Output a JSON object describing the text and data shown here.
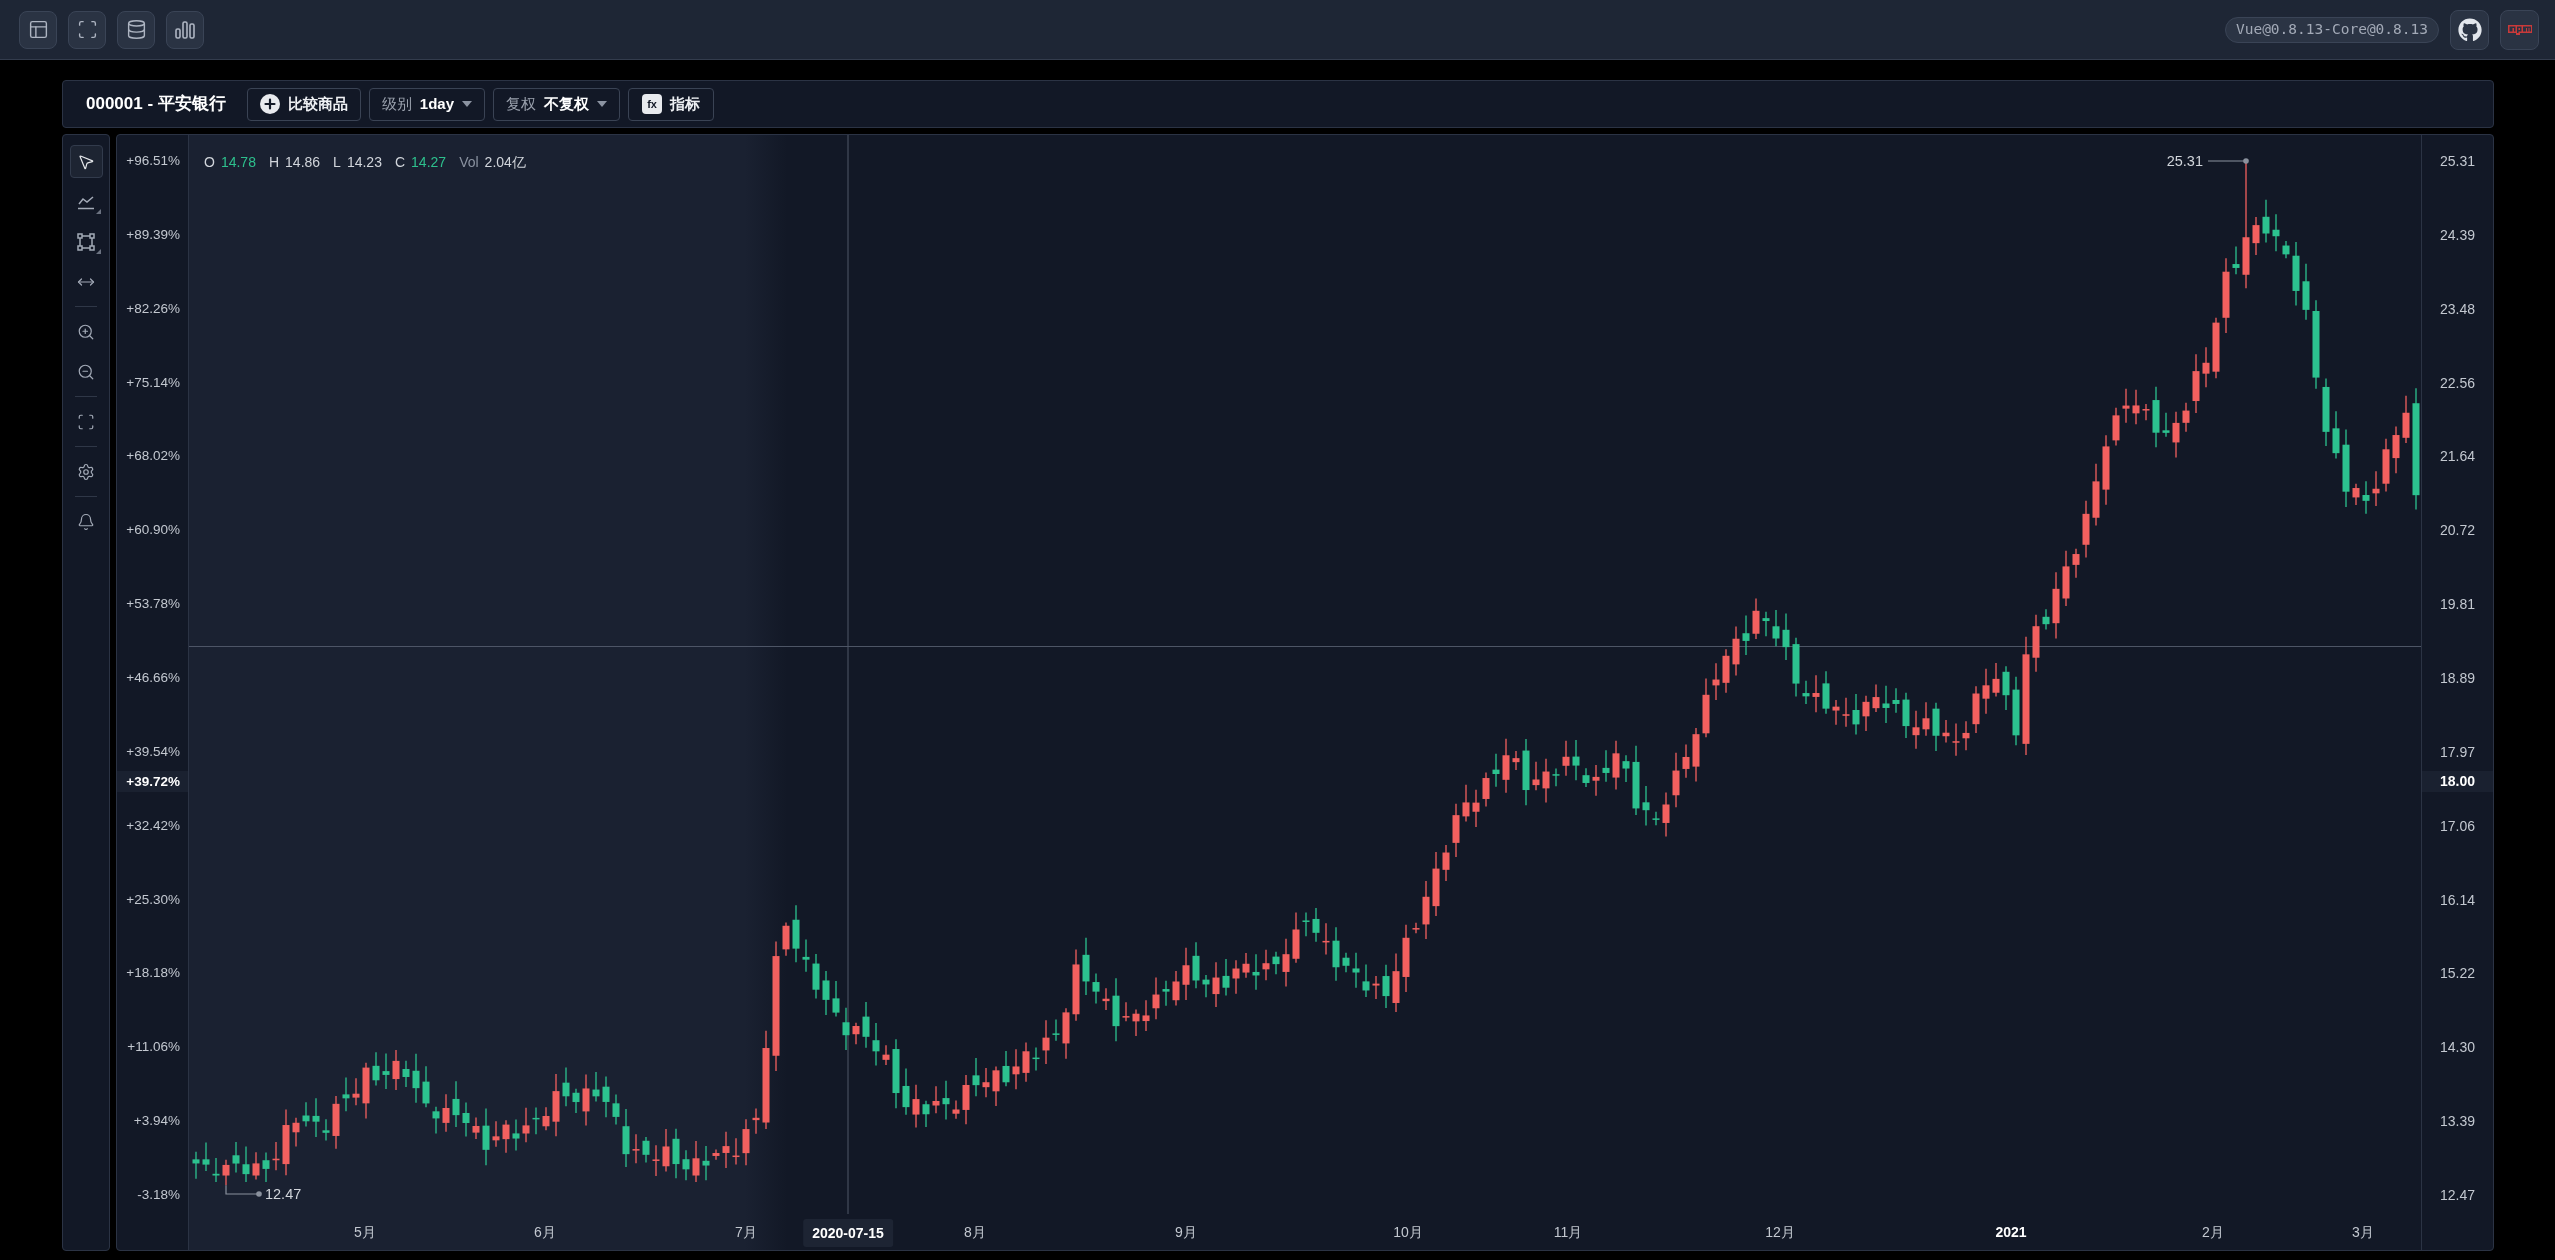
{
  "top_bar": {
    "tools": [
      {
        "kind": "layout"
      },
      {
        "kind": "fullscreen"
      },
      {
        "kind": "database"
      },
      {
        "kind": "bar-chart"
      }
    ],
    "version_badge": "Vue@0.8.13-Core@0.8.13",
    "links": [
      {
        "kind": "github"
      },
      {
        "kind": "npm"
      }
    ]
  },
  "chart_header": {
    "symbol": "000001 - 平安银行",
    "compare_button": {
      "label": "比较商品"
    },
    "period_select": {
      "label": "级别",
      "value": "1day"
    },
    "adjust_select": {
      "label": "复权",
      "value": "不复权"
    },
    "indicator_button": {
      "icon_text": "fx",
      "label": "指标"
    }
  },
  "drawing_toolbar": {
    "groups": [
      {
        "tools": [
          {
            "kind": "cursor",
            "selected": true,
            "submenu": false
          },
          {
            "kind": "trend-line",
            "selected": false,
            "submenu": true
          },
          {
            "kind": "rectangle",
            "selected": false,
            "submenu": true
          },
          {
            "kind": "measure",
            "selected": false,
            "submenu": false
          }
        ]
      },
      {
        "tools": [
          {
            "kind": "zoom-in",
            "selected": false,
            "submenu": false
          },
          {
            "kind": "zoom-out",
            "selected": false,
            "submenu": false
          }
        ]
      },
      {
        "tools": [
          {
            "kind": "fit",
            "selected": false,
            "submenu": false
          }
        ]
      },
      {
        "tools": [
          {
            "kind": "settings",
            "selected": false,
            "submenu": false
          }
        ]
      },
      {
        "tools": [
          {
            "kind": "alert",
            "selected": false,
            "submenu": false
          }
        ]
      }
    ]
  },
  "legend": [
    {
      "label": "O",
      "value": "14.78",
      "kind": "price",
      "color": "#2dc08d"
    },
    {
      "label": "H",
      "value": "14.86",
      "kind": "price",
      "color": "#d1d5db"
    },
    {
      "label": "L",
      "value": "14.23",
      "kind": "price",
      "color": "#d1d5db"
    },
    {
      "label": "C",
      "value": "14.27",
      "kind": "price",
      "color": "#2dc08d"
    },
    {
      "label": "Vol",
      "value": "2.04亿",
      "kind": "volume",
      "color": "#d1d5db"
    }
  ],
  "percent_axis": {
    "labels": [
      "+96.51%",
      "+89.39%",
      "+82.26%",
      "+75.14%",
      "+68.02%",
      "+60.90%",
      "+53.78%",
      "+46.66%",
      "+39.54%",
      "+32.42%",
      "+25.30%",
      "+18.18%",
      "+11.06%",
      "+3.94%",
      "-3.18%"
    ],
    "crosshair_label": "+39.72%"
  },
  "price_axis": {
    "labels": [
      "25.31",
      "24.39",
      "23.48",
      "22.56",
      "21.64",
      "20.72",
      "19.81",
      "18.89",
      "17.97",
      "17.06",
      "16.14",
      "15.22",
      "14.30",
      "13.39",
      "12.47"
    ],
    "crosshair_label": "18.00"
  },
  "time_axis": {
    "labels": [
      {
        "text": "5月",
        "kind": "month"
      },
      {
        "text": "6月",
        "kind": "month"
      },
      {
        "text": "7月",
        "kind": "month"
      },
      {
        "text": "8月",
        "kind": "month"
      },
      {
        "text": "9月",
        "kind": "month"
      },
      {
        "text": "10月",
        "kind": "month"
      },
      {
        "text": "11月",
        "kind": "month"
      },
      {
        "text": "12月",
        "kind": "month"
      },
      {
        "text": "2021",
        "kind": "year"
      },
      {
        "text": "2月",
        "kind": "month"
      },
      {
        "text": "3月",
        "kind": "month"
      }
    ],
    "crosshair_label": "2020-07-15"
  },
  "extremes": {
    "high": "25.31",
    "low": "12.47"
  }
}
